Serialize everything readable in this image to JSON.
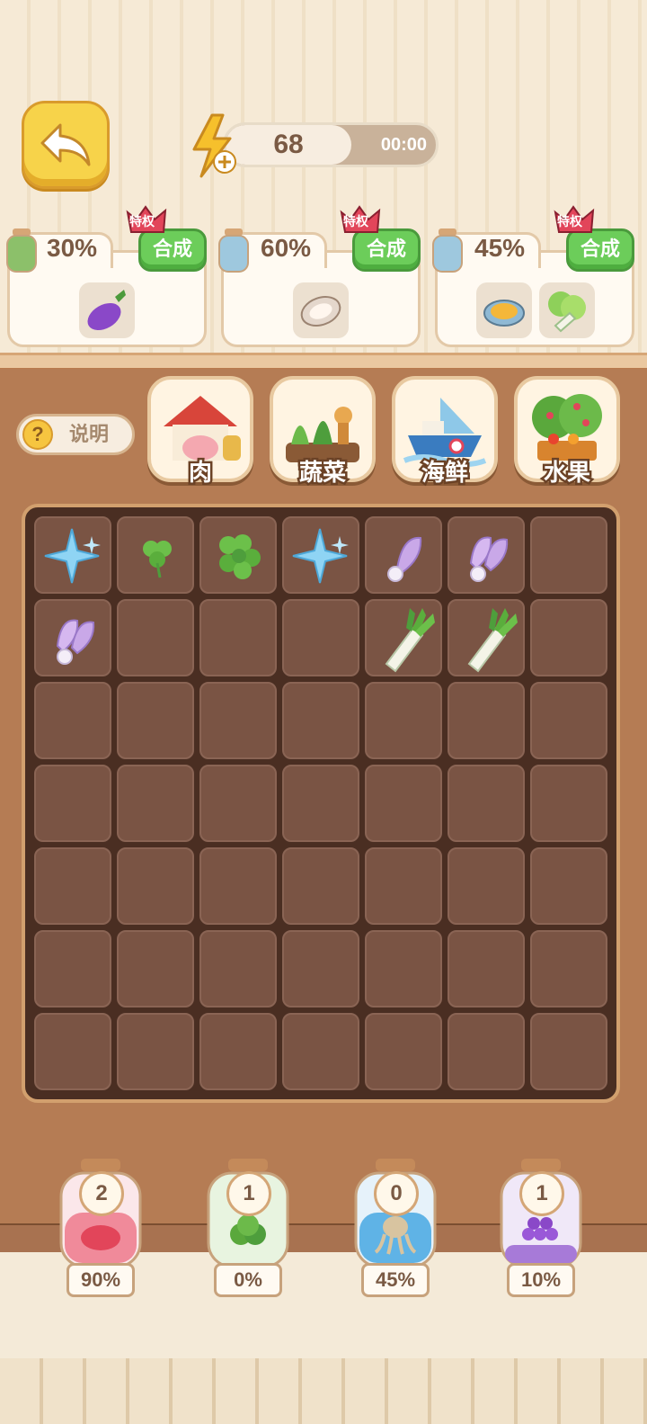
{
  "header": {
    "back_icon": "back-arrow-icon",
    "energy": {
      "count": "68",
      "timer": "00:00",
      "icon": "lightning-plus-icon"
    }
  },
  "recipes": [
    {
      "percent": "30%",
      "merge_label": "合成",
      "badge": "特权",
      "jar_color": "#8cc06a",
      "items": [
        "eggplant-icon"
      ]
    },
    {
      "percent": "60%",
      "merge_label": "合成",
      "badge": "特权",
      "jar_color": "#9ec8de",
      "items": [
        "oyster-icon"
      ]
    },
    {
      "percent": "45%",
      "merge_label": "合成",
      "badge": "特权",
      "jar_color": "#9ec8de",
      "items": [
        "clam-icon",
        "bok-choy-icon"
      ]
    }
  ],
  "help": {
    "label": "说明",
    "icon": "question-icon"
  },
  "categories": [
    {
      "label": "肉",
      "icon": "pig-barn-icon"
    },
    {
      "label": "蔬菜",
      "icon": "vegetable-garden-icon"
    },
    {
      "label": "海鲜",
      "icon": "fishing-boat-icon"
    },
    {
      "label": "水果",
      "icon": "fruit-tree-icon"
    }
  ],
  "board": {
    "rows": 7,
    "cols": 7,
    "pieces": [
      {
        "row": 0,
        "col": 0,
        "item": "blue-sparkle-icon"
      },
      {
        "row": 0,
        "col": 1,
        "item": "clover-small-icon"
      },
      {
        "row": 0,
        "col": 2,
        "item": "clover-large-icon"
      },
      {
        "row": 0,
        "col": 3,
        "item": "blue-sparkle-icon"
      },
      {
        "row": 0,
        "col": 4,
        "item": "turnip-seed-icon"
      },
      {
        "row": 0,
        "col": 5,
        "item": "turnip-double-icon"
      },
      {
        "row": 1,
        "col": 0,
        "item": "turnip-double-icon"
      },
      {
        "row": 1,
        "col": 4,
        "item": "leek-icon"
      },
      {
        "row": 1,
        "col": 5,
        "item": "leek-icon"
      }
    ]
  },
  "jars": [
    {
      "count": "2",
      "percent": "90%",
      "icon": "meat-jar-icon",
      "color": "#f08a9a"
    },
    {
      "count": "1",
      "percent": "0%",
      "icon": "broccoli-jar-icon",
      "color": "#b6dca2"
    },
    {
      "count": "0",
      "percent": "45%",
      "icon": "octopus-jar-icon",
      "color": "#5fb3e6"
    },
    {
      "count": "1",
      "percent": "10%",
      "icon": "grape-jar-icon",
      "color": "#a77ad8"
    }
  ]
}
